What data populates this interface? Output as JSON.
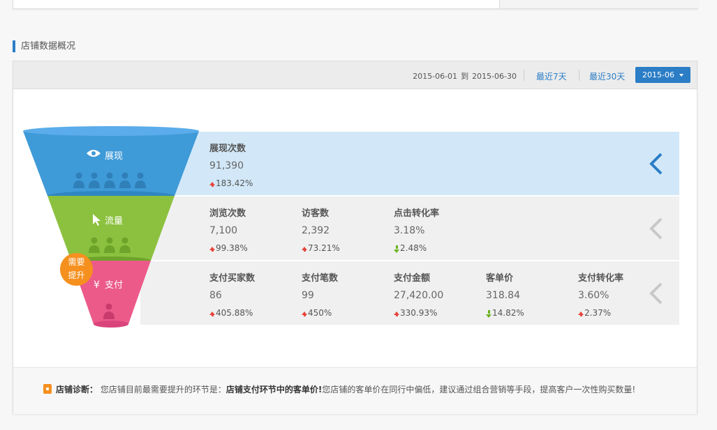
{
  "section_title": "店铺数据概况",
  "toolbar": {
    "date_from": "2015-06-01",
    "date_to_word": "到",
    "date_to": "2015-06-30",
    "last7": "最近7天",
    "last30": "最近30天",
    "month": "2015-06"
  },
  "funnel": {
    "stage1": "展现",
    "stage2": "流量",
    "stage3": "支付",
    "yen": "¥",
    "badge_line1": "需要",
    "badge_line2": "提升"
  },
  "rows": {
    "exposure": [
      {
        "label": "展现次数",
        "value": "91,390",
        "change": "183.42%",
        "dir": "up"
      }
    ],
    "traffic": [
      {
        "label": "浏览次数",
        "value": "7,100",
        "change": "99.38%",
        "dir": "up"
      },
      {
        "label": "访客数",
        "value": "2,392",
        "change": "73.21%",
        "dir": "up"
      },
      {
        "label": "点击转化率",
        "value": "3.18%",
        "change": "2.48%",
        "dir": "down"
      }
    ],
    "payment": [
      {
        "label": "支付买家数",
        "value": "86",
        "change": "405.88%",
        "dir": "up"
      },
      {
        "label": "支付笔数",
        "value": "99",
        "change": "450%",
        "dir": "up"
      },
      {
        "label": "支付金额",
        "value": "27,420.00",
        "change": "330.93%",
        "dir": "up"
      },
      {
        "label": "客单价",
        "value": "318.84",
        "change": "14.82%",
        "dir": "down"
      },
      {
        "label": "支付转化率",
        "value": "3.60%",
        "change": "2.37%",
        "dir": "up"
      }
    ]
  },
  "footer": {
    "diag_label": "店铺诊断：",
    "diag_pre": "您店铺目前最需要提升的环节是：",
    "diag_bold": "店铺支付环节中的客单价!",
    "diag_post": "您店铺的客单价在同行中偏低，建议通过组合营销等手段，提高客户一次性购买数量!"
  },
  "colors": {
    "accent": "#2b7dc6",
    "funnel_blue": "#3f9ad8",
    "funnel_green": "#8cc13f",
    "funnel_pink": "#ec5a8a",
    "badge": "#f5901e",
    "up": "#e8453c",
    "down": "#6ab21d"
  }
}
